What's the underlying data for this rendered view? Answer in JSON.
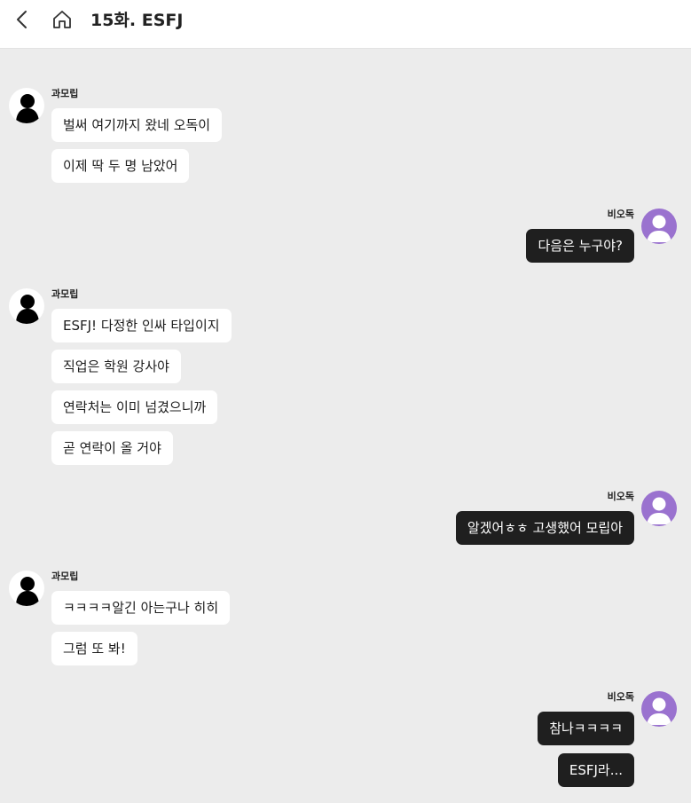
{
  "header": {
    "title": "15화. ESFJ",
    "back_icon": "chevron-left-icon",
    "home_icon": "home-icon"
  },
  "participants": {
    "other_name": "과모립",
    "me_name": "비오독"
  },
  "colors": {
    "background": "#ececec",
    "other_bubble": "#ffffff",
    "my_bubble": "#1f1f1f",
    "my_avatar": "#9a72cf"
  },
  "messages": [
    {
      "sender": "과모립",
      "lines": [
        "벌써 여기까지 왔네 오독이",
        "이제 딱 두 명 남았어"
      ]
    },
    {
      "sender": "비오독",
      "lines": [
        "다음은 누구야?"
      ]
    },
    {
      "sender": "과모립",
      "lines": [
        "ESFJ! 다정한 인싸 타입이지",
        "직업은 학원 강사야",
        "연락처는 이미 넘겼으니까",
        "곧 연락이 올 거야"
      ]
    },
    {
      "sender": "비오독",
      "lines": [
        "알겠어ㅎㅎ 고생했어 모립아"
      ]
    },
    {
      "sender": "과모립",
      "lines": [
        "ㅋㅋㅋㅋ알긴 아는구나 히히",
        "그럼 또 봐!"
      ]
    },
    {
      "sender": "비오독",
      "lines": [
        "참나ㅋㅋㅋㅋ",
        "ESFJ라..."
      ]
    }
  ]
}
